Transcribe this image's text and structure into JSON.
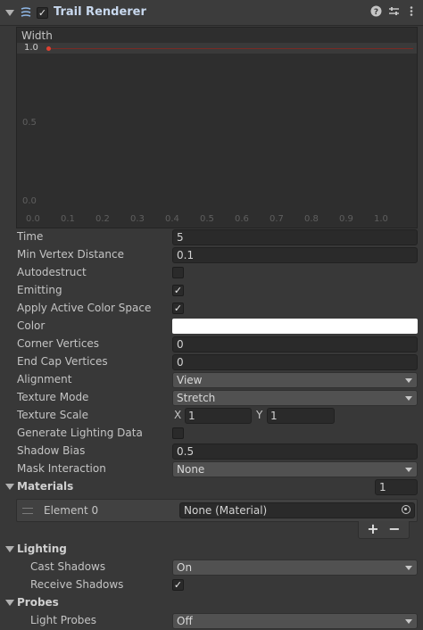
{
  "component": {
    "title": "Trail Renderer",
    "enabled": true,
    "icons": [
      "trail-renderer-icon",
      "help-icon",
      "presets-icon",
      "more-menu-icon"
    ]
  },
  "width_curve": {
    "label": "Width",
    "y_ticks": [
      "1.0",
      "0.5",
      "0.0"
    ],
    "x_ticks": [
      "0.0",
      "0.1",
      "0.2",
      "0.3",
      "0.4",
      "0.5",
      "0.6",
      "0.7",
      "0.8",
      "0.9",
      "1.0"
    ],
    "curve_color": "#c0392b"
  },
  "fields": {
    "time": {
      "label": "Time",
      "value": "5"
    },
    "min_vertex_distance": {
      "label": "Min Vertex Distance",
      "value": "0.1"
    },
    "autodestruct": {
      "label": "Autodestruct",
      "checked": false
    },
    "emitting": {
      "label": "Emitting",
      "checked": true
    },
    "apply_active_color_space": {
      "label": "Apply Active Color Space",
      "checked": true
    },
    "color": {
      "label": "Color",
      "value": "#ffffff"
    },
    "corner_vertices": {
      "label": "Corner Vertices",
      "value": "0"
    },
    "end_cap_vertices": {
      "label": "End Cap Vertices",
      "value": "0"
    },
    "alignment": {
      "label": "Alignment",
      "value": "View"
    },
    "texture_mode": {
      "label": "Texture Mode",
      "value": "Stretch"
    },
    "texture_scale": {
      "label": "Texture Scale",
      "x_label": "X",
      "x": "1",
      "y_label": "Y",
      "y": "1"
    },
    "generate_lighting_data": {
      "label": "Generate Lighting Data",
      "checked": false
    },
    "shadow_bias": {
      "label": "Shadow Bias",
      "value": "0.5"
    },
    "mask_interaction": {
      "label": "Mask Interaction",
      "value": "None"
    }
  },
  "materials": {
    "title": "Materials",
    "count": "1",
    "elements": [
      {
        "label": "Element 0",
        "value": "None (Material)"
      }
    ],
    "add_label": "+",
    "remove_label": "−"
  },
  "lighting": {
    "title": "Lighting",
    "cast_shadows": {
      "label": "Cast Shadows",
      "value": "On"
    },
    "receive_shadows": {
      "label": "Receive Shadows",
      "checked": true
    }
  },
  "probes": {
    "title": "Probes",
    "light_probes": {
      "label": "Light Probes",
      "value": "Off"
    }
  }
}
